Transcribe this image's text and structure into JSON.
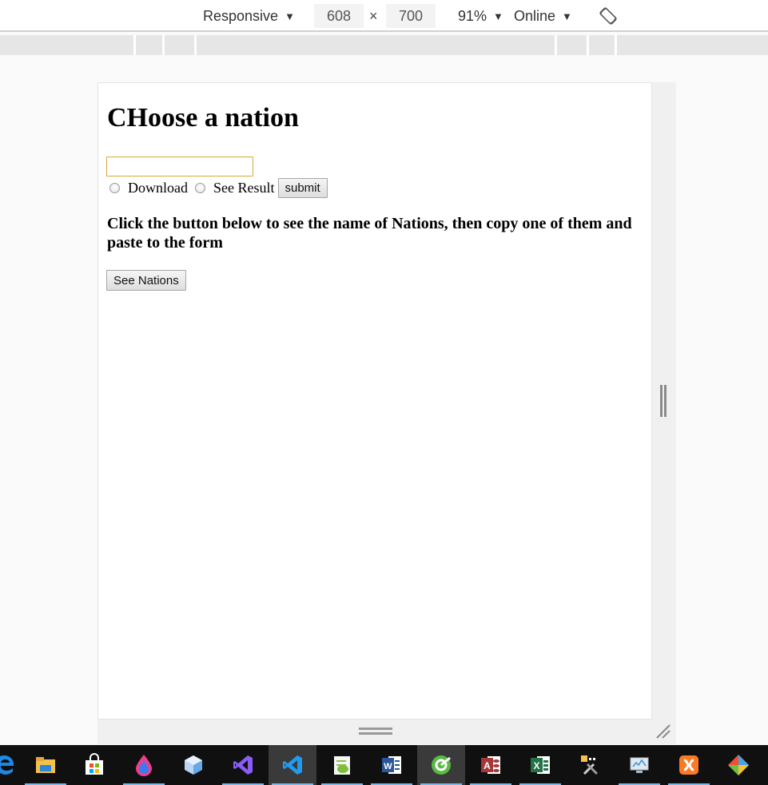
{
  "device_toolbar": {
    "device_label": "Responsive",
    "width_value": "608",
    "times_symbol": "×",
    "height_value": "700",
    "zoom_label": "91%",
    "throttle_label": "Online",
    "dropdown_arrow": "▼"
  },
  "page": {
    "title": "CHoose a nation",
    "nation_input_value": "",
    "radio_download_label": "Download",
    "radio_see_result_label": "See Result",
    "submit_label": "submit",
    "instructions": "Click the button below to see the name of Nations, then copy one of them and paste to the form",
    "see_nations_label": "See Nations"
  },
  "taskbar": {
    "apps": [
      {
        "icon": "edge-icon"
      },
      {
        "icon": "file-explorer-icon"
      },
      {
        "icon": "store-icon"
      },
      {
        "icon": "paint-drop-icon"
      },
      {
        "icon": "3d-box-icon"
      },
      {
        "icon": "visual-studio-icon"
      },
      {
        "icon": "vscode-icon"
      },
      {
        "icon": "notepad-plus-plus-icon"
      },
      {
        "icon": "word-icon"
      },
      {
        "icon": "browser-icon"
      },
      {
        "icon": "access-icon"
      },
      {
        "icon": "excel-icon"
      },
      {
        "icon": "tools-icon"
      },
      {
        "icon": "remote-desktop-icon"
      },
      {
        "icon": "xampp-icon"
      },
      {
        "icon": "git-icon"
      }
    ]
  },
  "colors": {
    "input_focus_border": "#d8a836",
    "taskbar_bg": "#101010",
    "taskbar_running_indicator": "#76b9ed"
  }
}
